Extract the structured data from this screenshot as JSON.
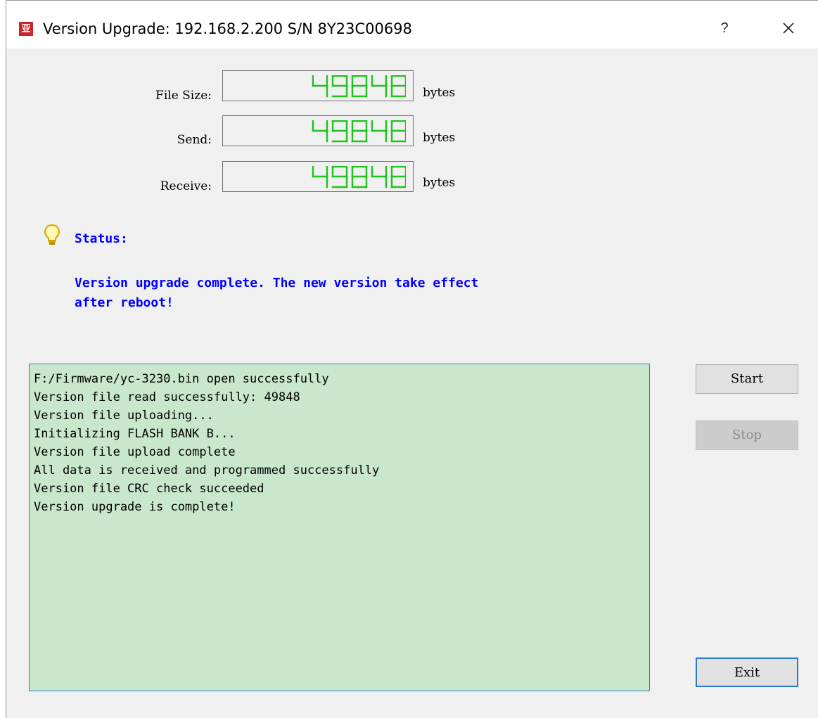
{
  "window": {
    "title": "Version Upgrade: 192.168.2.200  S/N 8Y23C00698",
    "icon_name": "app-logo-icon",
    "help_label": "?",
    "close_icon": "close-icon"
  },
  "counters": [
    {
      "label": "File Size:",
      "value": "49848",
      "unit": "bytes"
    },
    {
      "label": "Send:",
      "value": "49848",
      "unit": "bytes"
    },
    {
      "label": "Receive:",
      "value": "49848",
      "unit": "bytes"
    }
  ],
  "status": {
    "icon_name": "lightbulb-icon",
    "label": "Status:",
    "message_line1": "Version upgrade complete. The new version take effect",
    "message_line2": "after reboot!"
  },
  "log": [
    "F:/Firmware/yc-3230.bin open successfully",
    "Version file read successfully: 49848",
    "Version file uploading...",
    "Initializing FLASH BANK B...",
    "Version file upload complete",
    "All data is received and programmed successfully",
    "Version file CRC check succeeded",
    "Version upgrade is complete!"
  ],
  "buttons": {
    "start": "Start",
    "stop": "Stop",
    "exit": "Exit"
  },
  "colors": {
    "lcd_digits": "#1fc21f",
    "status_text": "#0000ff",
    "log_background": "#c9e7cb",
    "focus_border": "#2a7ad0"
  }
}
